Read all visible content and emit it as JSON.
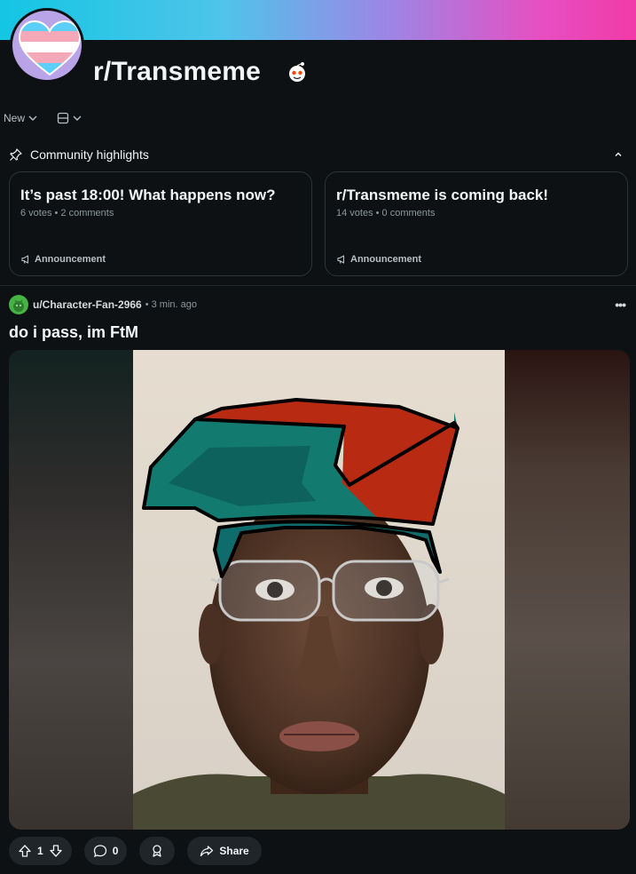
{
  "subreddit": {
    "name": "r/Transmeme"
  },
  "sort": {
    "label": "New"
  },
  "highlights": {
    "header": "Community highlights",
    "cards": [
      {
        "title": "It’s past 18:00! What happens now?",
        "meta": "6 votes • 2 comments",
        "flair": "Announcement"
      },
      {
        "title": "r/Transmeme is coming back!",
        "meta": "14 votes • 0 comments",
        "flair": "Announcement"
      }
    ]
  },
  "post": {
    "author": "u/Character-Fan-2966",
    "time": "• 3 min. ago",
    "more": "•••",
    "title": "do i pass, im FtM",
    "votes": "1",
    "comments": "0",
    "share_label": "Share"
  },
  "colors": {
    "accent_pink": "#f23aa8",
    "accent_cyan": "#13c6e3",
    "background": "#0e1113"
  },
  "icons": [
    "trans-heart-avatar",
    "snoo-icon",
    "chevron-down-icon",
    "card-view-icon",
    "pin-icon",
    "chevron-up-icon",
    "megaphone-icon",
    "upvote-icon",
    "downvote-icon",
    "comment-icon",
    "award-icon",
    "share-icon"
  ]
}
